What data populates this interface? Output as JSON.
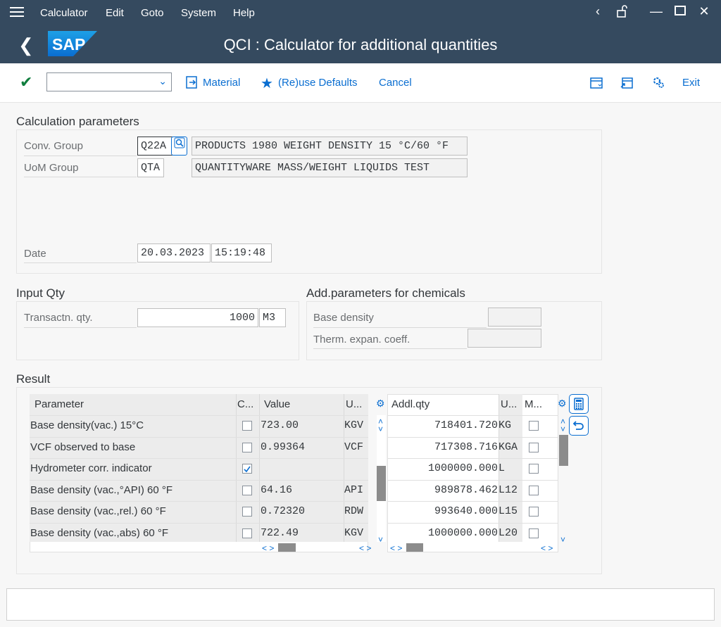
{
  "menu": {
    "items": [
      "Calculator",
      "Edit",
      "Goto",
      "System",
      "Help"
    ]
  },
  "title": "QCI : Calculator for additional quantities",
  "logo": "SAP",
  "toolbar": {
    "material": "Material",
    "reuse_defaults": "(Re)use Defaults",
    "cancel": "Cancel",
    "exit": "Exit",
    "command_value": ""
  },
  "calc_params": {
    "title": "Calculation parameters",
    "conv_group_label": "Conv. Group",
    "conv_group_value": "Q22A",
    "conv_group_desc": "PRODUCTS 1980 WEIGHT DENSITY 15 °C/60 °F",
    "uom_group_label": "UoM Group",
    "uom_group_value": "QTA",
    "uom_group_desc": "QUANTITYWARE MASS/WEIGHT LIQUIDS TEST",
    "date_label": "Date",
    "date_value": "20.03.2023",
    "time_value": "15:19:48"
  },
  "input_qty": {
    "title": "Input Qty",
    "label": "Transactn. qty.",
    "value": "1000",
    "unit": "M3"
  },
  "chem_params": {
    "title": "Add.parameters for chemicals",
    "base_density_label": "Base density",
    "therm_label": "Therm. expan. coeff.",
    "base_density_value": "",
    "therm_value": ""
  },
  "result": {
    "title": "Result",
    "left_headers": {
      "parameter": "Parameter",
      "c": "C...",
      "value": "Value",
      "unit": "U..."
    },
    "right_headers": {
      "qty": "Addl.qty",
      "unit": "U...",
      "m": "M..."
    },
    "rows": [
      {
        "parameter": "Base density(vac.) 15°C",
        "checked": false,
        "value": "723.00",
        "unit": "KGV",
        "qty": "718401.720",
        "qty_unit": "KG",
        "m": false
      },
      {
        "parameter": "VCF observed to base",
        "checked": false,
        "value": "0.99364",
        "unit": "VCF",
        "qty": "717308.716",
        "qty_unit": "KGA",
        "m": false
      },
      {
        "parameter": "Hydrometer corr. indicator",
        "checked": true,
        "value": "",
        "unit": "",
        "qty": "1000000.000",
        "qty_unit": "L",
        "m": false
      },
      {
        "parameter": "Base density (vac.,°API) 60 °F",
        "checked": false,
        "value": "64.16",
        "unit": "API",
        "qty": "989878.462",
        "qty_unit": "L12",
        "m": false
      },
      {
        "parameter": "Base density (vac.,rel.) 60 °F",
        "checked": false,
        "value": "0.72320",
        "unit": "RDW",
        "qty": "993640.000",
        "qty_unit": "L15",
        "m": false
      },
      {
        "parameter": "Base density (vac.,abs) 60 °F",
        "checked": false,
        "value": "722.49",
        "unit": "KGV",
        "qty": "1000000.000",
        "qty_unit": "L20",
        "m": false
      }
    ]
  },
  "status_text": ""
}
